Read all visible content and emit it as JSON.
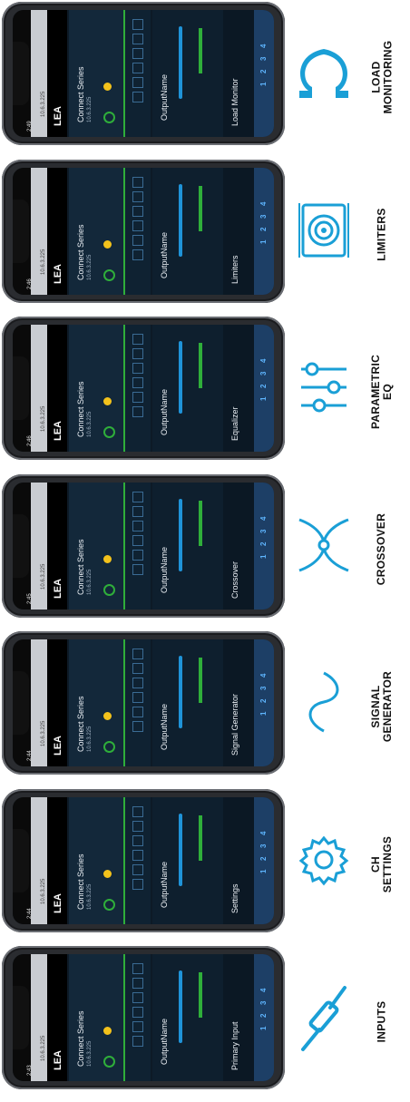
{
  "features": [
    {
      "label": "LOAD\nMONITORING",
      "icon": "omega-icon",
      "panel_title": "Load Monitor",
      "time": "2:49",
      "url": "10.6.3.225",
      "ip": "10.6.3.225"
    },
    {
      "label": "LIMITERS",
      "icon": "speaker-icon",
      "panel_title": "Limiters",
      "time": "2:46",
      "url": "10.6.3.225",
      "ip": "10.6.3.225"
    },
    {
      "label": "PARAMETRIC\nEQ",
      "icon": "eq-sliders-icon",
      "panel_title": "Equalizer",
      "time": "2:46",
      "url": "10.6.3.225",
      "ip": "10.6.3.225"
    },
    {
      "label": "CROSSOVER",
      "icon": "crossover-icon",
      "panel_title": "Crossover",
      "time": "2:45",
      "url": "10.6.3.225",
      "ip": "10.6.3.225"
    },
    {
      "label": "SIGNAL\nGENERATOR",
      "icon": "sine-wave-icon",
      "panel_title": "Signal Generator",
      "time": "2:44",
      "url": "10.6.3.225",
      "ip": "10.6.3.225"
    },
    {
      "label": "CH\nSETTINGS",
      "icon": "gear-icon",
      "panel_title": "Settings",
      "time": "2:44",
      "url": "10.6.3.225",
      "ip": "10.6.3.225"
    },
    {
      "label": "INPUTS",
      "icon": "audio-jack-icon",
      "panel_title": "Primary Input",
      "time": "2:43",
      "url": "10.6.3.225",
      "ip": "10.6.3.225"
    }
  ],
  "app": {
    "brand": "LEA",
    "device_title": "Connect Series",
    "output_name": "OutputName",
    "tabs": [
      "1",
      "2",
      "3",
      "4"
    ]
  },
  "colors": {
    "accent": "#1a9fd6",
    "green": "#2fae3a",
    "yellow": "#f3c21b",
    "bg": "#0d1a26"
  }
}
